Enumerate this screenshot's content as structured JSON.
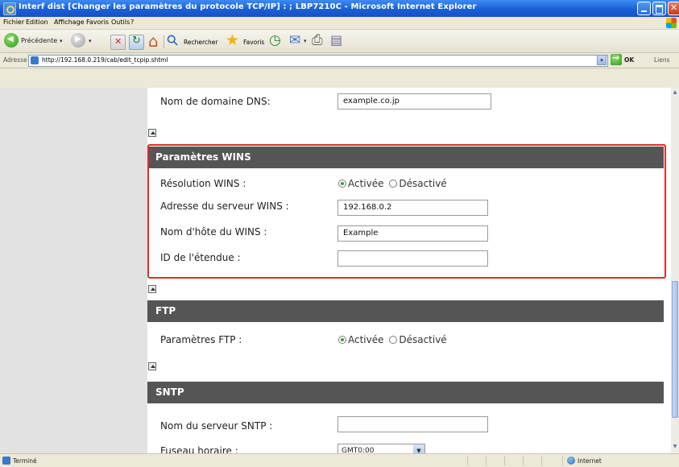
{
  "window": {
    "title": "Interf dist [Changer les paramètres du protocole TCP/IP] : ; LBP7210C - Microsoft Internet Explorer"
  },
  "menubar": {
    "items": [
      "Fichier",
      "Edition",
      "Affichage",
      "Favoris",
      "Outils",
      "?"
    ]
  },
  "toolbar": {
    "back_label": "Précédente",
    "search_label": "Rechercher",
    "favorites_label": "Favoris"
  },
  "addressbar": {
    "label": "Adresse",
    "url": "http://192.168.0.219/cab/edit_tcpip.shtml",
    "go_label": "OK",
    "links_label": "Liens"
  },
  "dns": {
    "label": "Nom de domaine DNS:",
    "value": "example.co.jp"
  },
  "wins": {
    "header": "Paramètres WINS",
    "resolution_label": "Résolution WINS :",
    "server_label": "Adresse du serveur WINS :",
    "server_value": "192.168.0.2",
    "host_label": "Nom d'hôte du WINS :",
    "host_value": "Example",
    "scope_label": "ID de l'étendue :",
    "scope_value": ""
  },
  "radio": {
    "on_label": "Activée",
    "off_label": "Désactivé"
  },
  "ftp": {
    "header": "FTP",
    "settings_label": "Paramètres FTP :"
  },
  "sntp": {
    "header": "SNTP",
    "server_label": "Nom du serveur SNTP :",
    "server_value": "",
    "timezone_label": "Fuseau horaire :",
    "timezone_value": "GMT0:00"
  },
  "statusbar": {
    "left_text": "Terminé",
    "zone_text": "Internet"
  },
  "colors": {
    "section_header_bg": "#555555",
    "highlight_border": "#e52a2a",
    "side_panel": "#e2e2e2"
  }
}
